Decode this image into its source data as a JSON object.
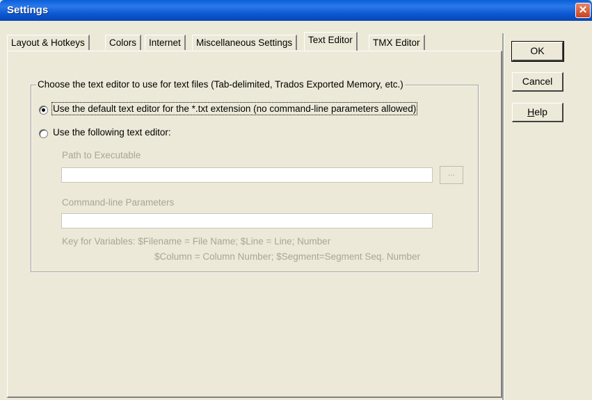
{
  "window": {
    "title": "Settings",
    "close_glyph": "✕"
  },
  "tabs": [
    {
      "label": "Layout & Hotkeys"
    },
    {
      "label": "Colors"
    },
    {
      "label": "Internet"
    },
    {
      "label": "Miscellaneous Settings"
    },
    {
      "label": "Text Editor",
      "active": true
    },
    {
      "label": "TMX Editor"
    }
  ],
  "buttons": {
    "ok": "OK",
    "cancel": "Cancel",
    "help": "Help"
  },
  "group": {
    "legend": "Choose the text editor to use for text files (Tab-delimited, Trados Exported Memory, etc.)",
    "option_default": "Use the default text editor for the *.txt extension (no command-line parameters allowed)",
    "option_custom": "Use the following text editor:",
    "selected_option": "default",
    "path_label": "Path to Executable",
    "path_value": "",
    "browse_label": "...",
    "params_label": "Command-line Parameters",
    "params_value": "",
    "key_line1": "Key for Variables:  $Filename = File Name; $Line = Line; Number",
    "key_line2": "$Column = Column Number; $Segment=Segment Seq. Number"
  }
}
